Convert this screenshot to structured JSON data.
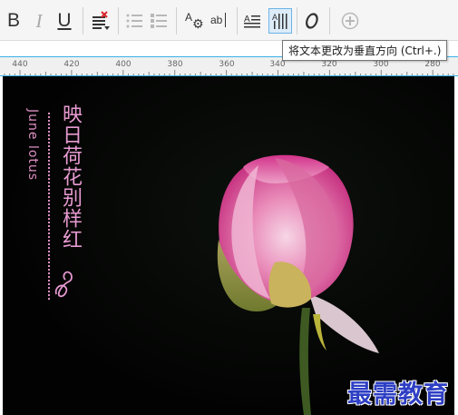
{
  "toolbar": {
    "bold_label": "B",
    "italic_label": "I",
    "underline_label": "U",
    "small_caps_label": "A",
    "char_spacing_label": "ab",
    "icons": [
      "bold-icon",
      "italic-icon",
      "underline-icon",
      "clear-formatting-icon",
      "bullet-list-icon",
      "numbered-list-icon",
      "text-shadow-icon",
      "character-spacing-icon",
      "horizontal-text-icon",
      "vertical-text-icon",
      "text-effects-icon",
      "add-icon"
    ]
  },
  "tooltip": {
    "text": "将文本更改为垂直方向 (Ctrl+.)"
  },
  "ruler": {
    "labels": [
      "440",
      "420",
      "400",
      "380",
      "360",
      "340",
      "320",
      "300",
      "280"
    ]
  },
  "slide": {
    "subtitle": "June lotus",
    "title": "映日荷花别样红",
    "watermark": "最需教育",
    "colors": {
      "background": "#020202",
      "title_text": "#e79ad1",
      "watermark": "#2e3fc4"
    }
  }
}
